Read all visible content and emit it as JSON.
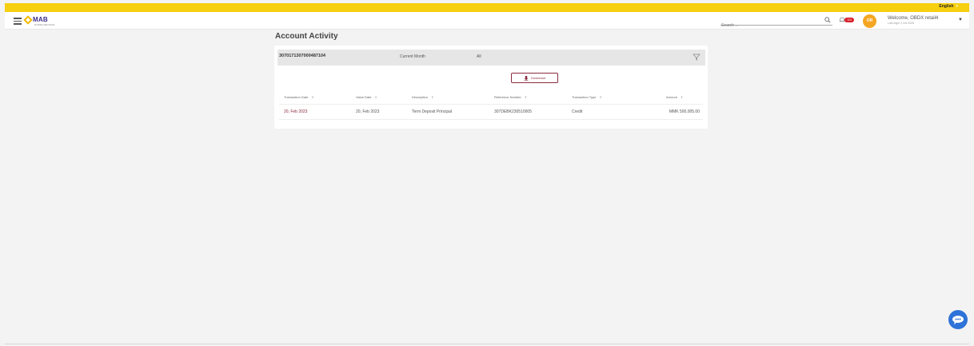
{
  "topbar": {
    "language": "English"
  },
  "header": {
    "logo_text": "MAB",
    "logo_subtext": "MYANMA APEX BANK",
    "search_placeholder": "Search ...",
    "notification_count": "124",
    "avatar_initials": "OR",
    "welcome_text": "Welcome, OBDX retail4",
    "last_login": "Last login 2 Oct 2025"
  },
  "page": {
    "title": "Account Activity"
  },
  "account_bar": {
    "account_number": "3070171307000487104",
    "period": "Current Month",
    "transaction_filter": "All"
  },
  "download_label": "Download",
  "table": {
    "headers": [
      "Transaction Date",
      "Value Date",
      "Description",
      "Reference Number",
      "Transaction Type",
      "Amount"
    ],
    "sort_glyph": "⇕",
    "rows": [
      [
        "20, Feb 2023",
        "20, Feb 2023",
        "Term Deposit Principal",
        "307DEBK230510005",
        "Credit",
        "MMK 500,005.00"
      ]
    ]
  },
  "colors": {
    "topbar": "#f6cf0f",
    "accent_maroon": "#8a2b3f",
    "avatar": "#f5a623",
    "chat": "#2e73d8",
    "badge": "#d81f2a"
  }
}
